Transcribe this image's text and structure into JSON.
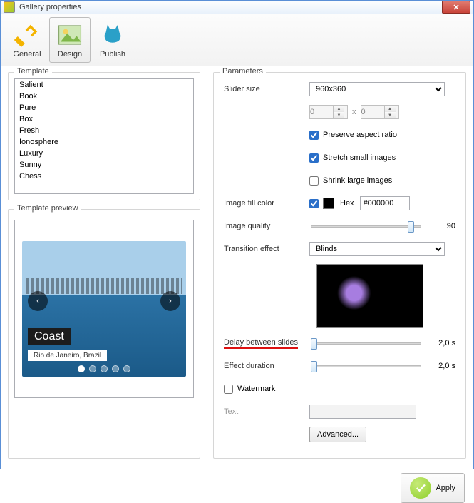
{
  "window": {
    "title": "Gallery properties"
  },
  "tabs": {
    "general": "General",
    "design": "Design",
    "publish": "Publish",
    "active": "design"
  },
  "template": {
    "group_label": "Template",
    "items": [
      "Salient",
      "Book",
      "Pure",
      "Box",
      "Fresh",
      "Ionosphere",
      "Luxury",
      "Sunny",
      "Chess"
    ]
  },
  "preview": {
    "group_label": "Template preview",
    "caption": "Coast",
    "subcaption": "Rio de Janeiro, Brazil",
    "dot_count": 5,
    "active_dot": 0
  },
  "params": {
    "group_label": "Parameters",
    "slider_size": {
      "label": "Slider size",
      "value": "960x360",
      "width": "0",
      "sep": "x",
      "height": "0"
    },
    "preserve_aspect": {
      "label": "Preserve aspect ratio",
      "checked": true
    },
    "stretch_small": {
      "label": "Stretch small images",
      "checked": true
    },
    "shrink_large": {
      "label": "Shrink large images",
      "checked": false
    },
    "fill_color": {
      "label": "Image fill color",
      "checked": true,
      "hex_label": "Hex",
      "value": "#000000"
    },
    "quality": {
      "label": "Image quality",
      "value": "90",
      "pos": 90
    },
    "transition": {
      "label": "Transition effect",
      "value": "Blinds"
    },
    "delay": {
      "label": "Delay between slides",
      "value": "2,0 s",
      "pos": 4
    },
    "duration": {
      "label": "Effect duration",
      "value": "2,0 s",
      "pos": 4
    },
    "watermark": {
      "label": "Watermark",
      "checked": false
    },
    "text": {
      "label": "Text",
      "value": ""
    },
    "advanced": {
      "label": "Advanced..."
    }
  },
  "footer": {
    "apply": "Apply"
  }
}
